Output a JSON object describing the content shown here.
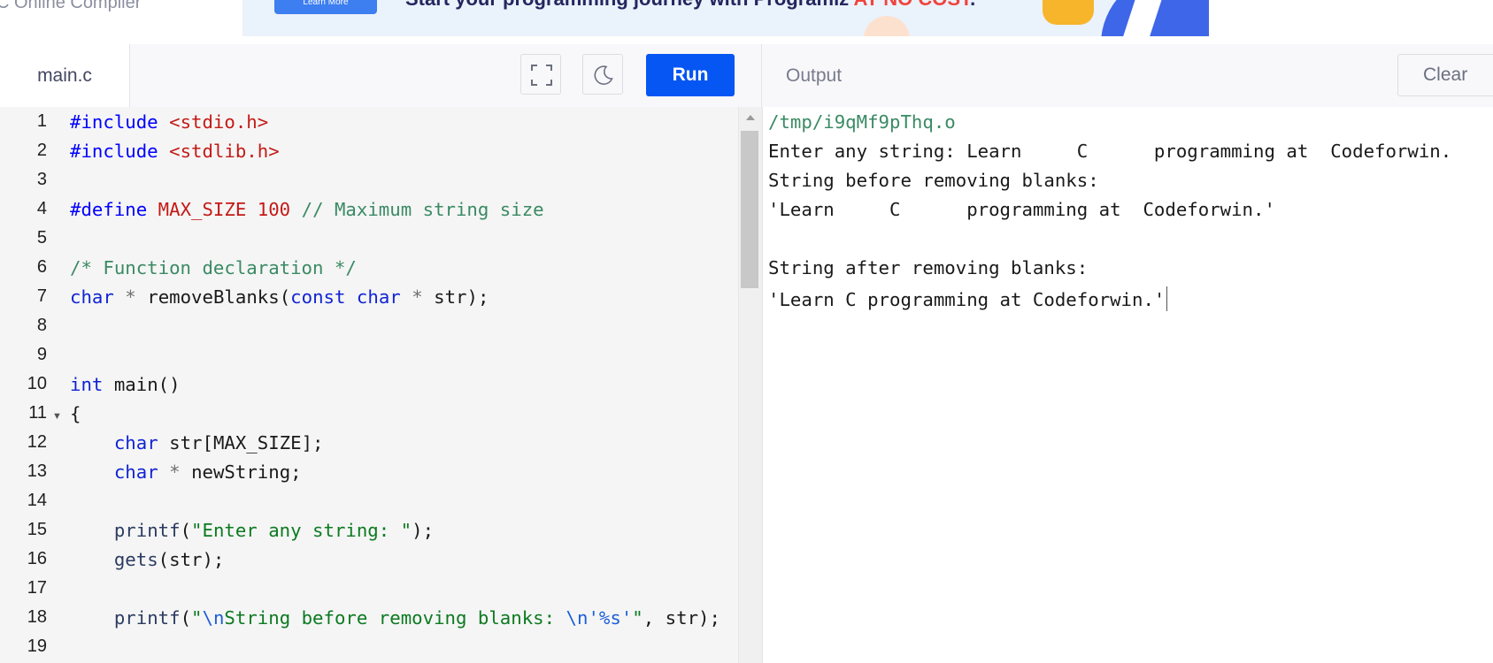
{
  "site": {
    "title": "C Online Compiler"
  },
  "banner": {
    "button_label": "Learn More",
    "text": "Start your programming journey with Programiz ",
    "accent_text": "AT NO COST",
    "text_end": "."
  },
  "editor": {
    "file_tab": "main.c",
    "run_label": "Run",
    "lines": [
      1,
      2,
      3,
      4,
      5,
      6,
      7,
      8,
      9,
      10,
      11,
      12,
      13,
      14,
      15,
      16,
      17,
      18,
      19
    ],
    "code": {
      "l1_a": "#include",
      "l1_b": "<stdio.h>",
      "l2_a": "#include",
      "l2_b": "<stdlib.h>",
      "l4_a": "#define",
      "l4_b": "MAX_SIZE",
      "l4_c": "100",
      "l4_d": "// Maximum string size",
      "l6": "/* Function declaration */",
      "l7_a": "char",
      "l7_b": "*",
      "l7_c": "removeBlanks(",
      "l7_d": "const",
      "l7_e": "char",
      "l7_f": "*",
      "l7_g": "str);",
      "l10_a": "int",
      "l10_b": "main()",
      "l11": "{",
      "l12_a": "char",
      "l12_b": "str[MAX_SIZE];",
      "l13_a": "char",
      "l13_b": "*",
      "l13_c": "newString;",
      "l15_a": "printf",
      "l15_b": "(",
      "l15_c": "\"Enter any string: \"",
      "l15_d": ");",
      "l16_a": "gets",
      "l16_b": "(str);",
      "l18_a": "printf",
      "l18_b": "(",
      "l18_c": "\"",
      "l18_d": "\\n",
      "l18_e": "String before removing blanks: ",
      "l18_f": "\\n",
      "l18_g": "'%s'",
      "l18_h": "\"",
      "l18_i": ", str);"
    }
  },
  "output": {
    "title": "Output",
    "clear_label": "Clear",
    "lines": [
      "/tmp/i9qMf9pThq.o",
      "Enter any string: Learn     C      programming at  Codeforwin.",
      "String before removing blanks:",
      "'Learn     C      programming at  Codeforwin.'",
      "",
      "String after removing blanks:",
      "'Learn C programming at Codeforwin.'"
    ]
  },
  "colors": {
    "run_button": "#0556f3",
    "keyword": "#1024d4",
    "string": "#0c7a20",
    "comment": "#3b8a64",
    "include": "#c41a16"
  },
  "icons": [
    "fullscreen-icon",
    "moon-icon",
    "fold-arrow-icon",
    "scroll-up-icon"
  ]
}
